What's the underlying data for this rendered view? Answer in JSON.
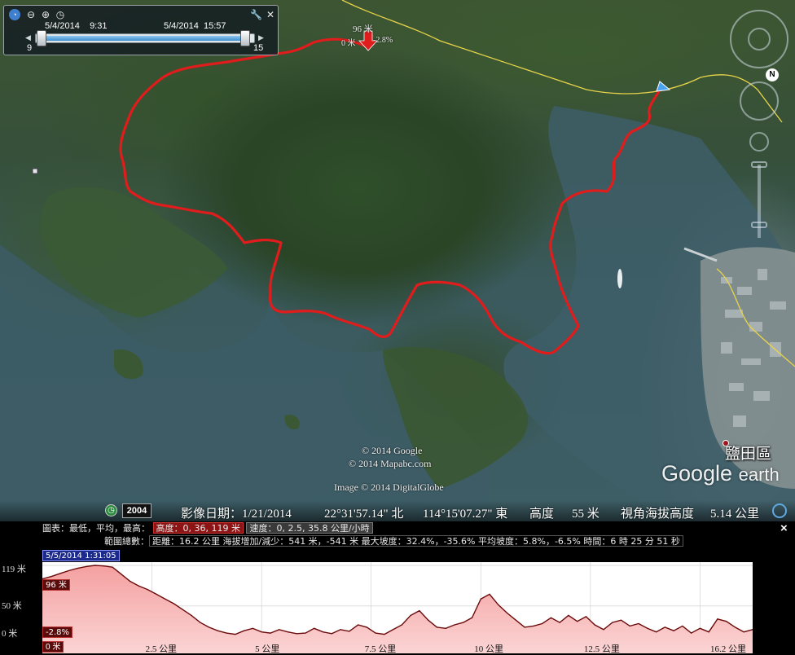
{
  "time_slider": {
    "start_date": "5/4/2014",
    "start_time": "9:31",
    "end_date": "5/4/2014",
    "end_time": "15:57",
    "start_num": "9",
    "end_num": "15",
    "icons": [
      "clock-icon",
      "zoom-out-icon",
      "zoom-in-icon",
      "loop-icon"
    ],
    "settings_icon": "wrench-icon",
    "close_icon": "close-icon"
  },
  "map_labels": {
    "marker_top": "96 米",
    "marker_left": "0 米",
    "marker_right": "-2.8%",
    "place_name": "鹽田區",
    "copyright_google": "© 2014 Google",
    "copyright_mapabc": "© 2014 Mapabc.com",
    "image_credit": "Image © 2014 DigitalGlobe",
    "logo_google": "Google",
    "logo_earth": "earth",
    "compass_n": "N"
  },
  "status_bar": {
    "year": "2004",
    "imagery_date": "影像日期：1/21/2014",
    "lat": "22°31'57.14\" 北",
    "lon": "114°15'07.27\" 東",
    "elev_label": "高度",
    "elev_value": "55 米",
    "eye_label": "視角海拔高度",
    "eye_value": "5.14 公里"
  },
  "profile": {
    "close": "×",
    "graph_label": "圖表：最低，平均，最高：",
    "height_box": "高度：0, 36, 119 米",
    "speed_box": "速度：0, 2.5, 35.8 公里/小時",
    "range_label": "範圍總數：",
    "range_text": "距離：16.2 公里 海拔增加/減少：541 米，-541 米 最大坡度：32.4%，-35.6% 平均坡度：5.8%，-6.5% 時間：6 時 25 分 51 秒",
    "date_flag": "5/5/2014 1:31:05",
    "y_max": "119 米",
    "y_mid": "50 米",
    "y_min": "0 米",
    "badge_top": "96 米",
    "badge_bottom": "-2.8%",
    "x_start": "0 米",
    "x_ticks": [
      "2.5 公里",
      "5 公里",
      "7.5 公里",
      "10 公里",
      "12.5 公里",
      "16.2 公里"
    ]
  },
  "chart_data": {
    "type": "area",
    "xlabel": "",
    "ylabel": "",
    "x_unit": "km",
    "xlim": [
      0,
      16.2
    ],
    "ylim": [
      0,
      119
    ],
    "x": [
      0,
      0.2,
      0.4,
      0.6,
      0.8,
      1.0,
      1.2,
      1.4,
      1.6,
      1.8,
      2.0,
      2.2,
      2.4,
      2.6,
      2.8,
      3.0,
      3.2,
      3.4,
      3.6,
      3.8,
      4.0,
      4.2,
      4.4,
      4.6,
      4.8,
      5.0,
      5.2,
      5.4,
      5.6,
      5.8,
      6.0,
      6.2,
      6.4,
      6.6,
      6.8,
      7.0,
      7.2,
      7.4,
      7.6,
      7.8,
      8.0,
      8.2,
      8.4,
      8.6,
      8.8,
      9.0,
      9.2,
      9.4,
      9.6,
      9.8,
      10.0,
      10.2,
      10.4,
      10.6,
      10.8,
      11.0,
      11.2,
      11.4,
      11.6,
      11.8,
      12.0,
      12.2,
      12.4,
      12.6,
      12.8,
      13.0,
      13.2,
      13.4,
      13.6,
      13.8,
      14.0,
      14.2,
      14.4,
      14.6,
      14.8,
      15.0,
      15.2,
      15.4,
      15.6,
      15.8,
      16.0,
      16.2
    ],
    "values": [
      96,
      100,
      105,
      110,
      114,
      117,
      119,
      118,
      116,
      104,
      92,
      84,
      78,
      70,
      62,
      54,
      44,
      34,
      22,
      14,
      8,
      4,
      2,
      8,
      12,
      6,
      4,
      10,
      6,
      3,
      4,
      12,
      6,
      3,
      10,
      7,
      18,
      14,
      4,
      2,
      10,
      18,
      34,
      42,
      26,
      14,
      12,
      18,
      22,
      30,
      62,
      70,
      52,
      38,
      26,
      14,
      16,
      20,
      30,
      22,
      34,
      24,
      32,
      18,
      10,
      22,
      26,
      16,
      20,
      12,
      6,
      14,
      8,
      16,
      4,
      12,
      6,
      28,
      24,
      14,
      6,
      10
    ]
  }
}
